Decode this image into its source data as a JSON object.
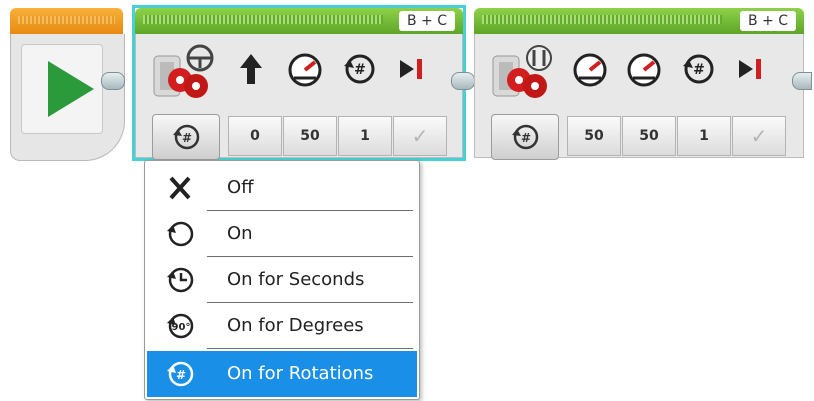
{
  "start_block": {
    "icon": "play-icon",
    "accent": "#2a9a3a"
  },
  "block1": {
    "port": "B + C",
    "selected": true,
    "mode_icon": "rotations-icon",
    "param_icons": [
      "steering-arrow-icon",
      "power-gauge-icon",
      "rotations-icon",
      "brake-icon"
    ],
    "values": [
      "0",
      "50",
      "1",
      "✓"
    ]
  },
  "block2": {
    "port": "B + C",
    "selected": false,
    "mode_icon": "rotations-icon",
    "param_icons": [
      "power-gauge-icon",
      "power-gauge-icon",
      "rotations-icon",
      "brake-icon"
    ],
    "values": [
      "50",
      "50",
      "1",
      "✓"
    ]
  },
  "mode_menu": {
    "items": [
      {
        "label": "Off",
        "icon": "close-icon"
      },
      {
        "label": "On",
        "icon": "rotate-icon"
      },
      {
        "label": "On for Seconds",
        "icon": "timer-icon"
      },
      {
        "label": "On for Degrees",
        "icon": "degrees-icon"
      },
      {
        "label": "On for Rotations",
        "icon": "rotations-icon"
      }
    ],
    "selected_index": 4,
    "highlight_color": "#1a8fe8"
  }
}
